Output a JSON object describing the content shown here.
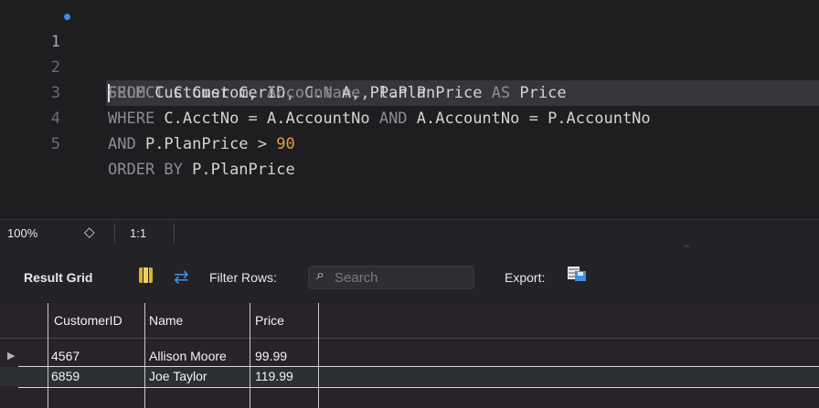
{
  "editor": {
    "lines": [
      {
        "number": "1",
        "text_parts": [
          {
            "t": "S",
            "c": "kw"
          },
          {
            "t": "ELECT",
            "c": "kw"
          },
          {
            "t": " C.CustomerID, C.",
            "c": ""
          },
          {
            "t": "Name",
            "c": "kw"
          },
          {
            "t": ", P.PlanPrice ",
            "c": ""
          },
          {
            "t": "AS",
            "c": "kw"
          },
          {
            "t": " Price",
            "c": ""
          }
        ]
      },
      {
        "number": "2",
        "text_parts": [
          {
            "t": "FROM",
            "c": "kw"
          },
          {
            "t": " Customer C, ",
            "c": ""
          },
          {
            "t": "Account",
            "c": "kw"
          },
          {
            "t": " A, Plan P",
            "c": ""
          }
        ]
      },
      {
        "number": "3",
        "text_parts": [
          {
            "t": "WHERE",
            "c": "kw"
          },
          {
            "t": " C.AcctNo = A.AccountNo ",
            "c": ""
          },
          {
            "t": "AND",
            "c": "kw"
          },
          {
            "t": " A.AccountNo = P.AccountNo",
            "c": ""
          }
        ]
      },
      {
        "number": "4",
        "text_parts": [
          {
            "t": "AND",
            "c": "kw"
          },
          {
            "t": " P.PlanPrice > ",
            "c": ""
          },
          {
            "t": "90",
            "c": "num"
          }
        ]
      },
      {
        "number": "5",
        "text_parts": [
          {
            "t": "ORDER BY",
            "c": "kw"
          },
          {
            "t": " P.PlanPrice",
            "c": ""
          }
        ]
      }
    ]
  },
  "status": {
    "zoom": "100%",
    "stepper_glyph": "◇",
    "cursor_position": "1:1"
  },
  "result_toolbar": {
    "title": "Result Grid",
    "grid_icon": "grid-icon",
    "refresh_icon": "refresh-arrows-icon",
    "filter_label": "Filter Rows:",
    "search_icon": "search-icon",
    "search_placeholder": "Search",
    "export_label": "Export:",
    "export_icon": "export-icon"
  },
  "grid": {
    "columns": [
      "CustomerID",
      "Name",
      "Price"
    ],
    "rows": [
      [
        "4567",
        "Allison Moore",
        "99.99"
      ],
      [
        "6859",
        "Joe Taylor",
        "119.99"
      ]
    ],
    "row_marker": "▶"
  },
  "colors": {
    "editor_bg": "#1e1e21",
    "keyword": "#8c8c92",
    "number": "#e59a3c",
    "accent": "#3d8bf0"
  }
}
